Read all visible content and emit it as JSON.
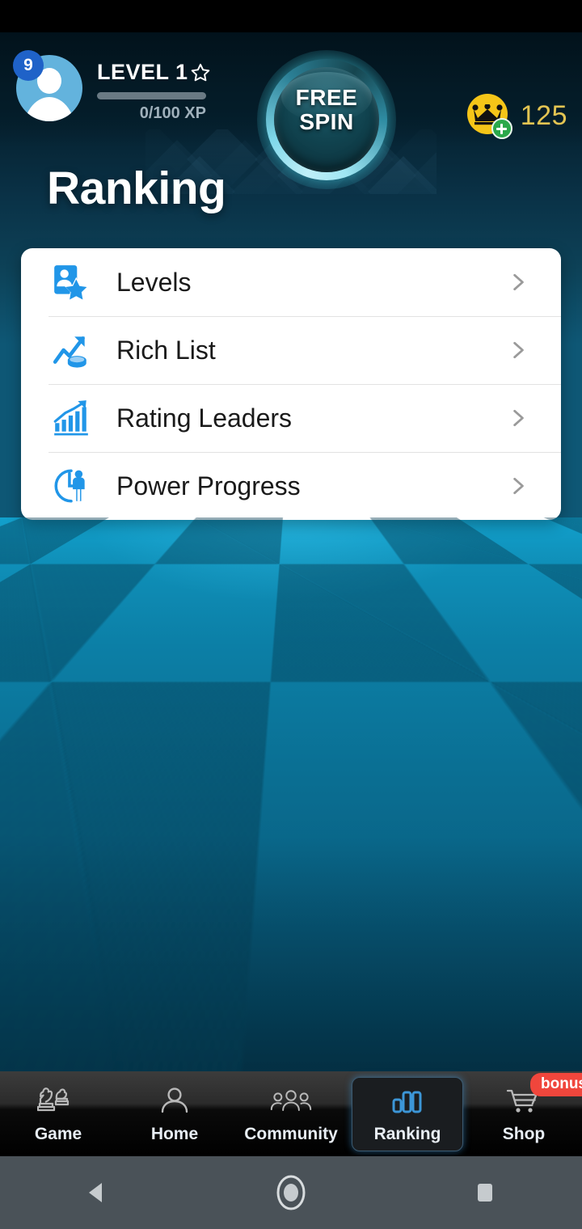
{
  "header": {
    "avatar_badge": "9",
    "level_label": "LEVEL 1",
    "xp_text": "0/100 XP",
    "xp_current": 0,
    "xp_max": 100,
    "xp_percent": 0,
    "spin_button_line1": "FREE",
    "spin_button_line2": "SPIN",
    "coin_count": "125",
    "colors": {
      "coin": "#f5c518",
      "coin_text": "#e3c452",
      "plus_badge": "#2aa84a",
      "badge_blue": "#1f62c8",
      "spin_glow": "#46dcf0"
    }
  },
  "page": {
    "title": "Ranking"
  },
  "menu": {
    "items": [
      {
        "label": "Levels",
        "icon": "levels-star-icon",
        "chevron": "chevron-right-icon"
      },
      {
        "label": "Rich List",
        "icon": "trend-coin-icon",
        "chevron": "chevron-right-icon"
      },
      {
        "label": "Rating Leaders",
        "icon": "bar-chart-trend-icon",
        "chevron": "chevron-right-icon"
      },
      {
        "label": "Power Progress",
        "icon": "clock-person-icon",
        "chevron": "chevron-right-icon"
      }
    ],
    "accent_color": "#2196e8"
  },
  "bottom_nav": {
    "active": "Ranking",
    "items": [
      {
        "label": "Game",
        "icon": "chess-pieces-icon",
        "active": false,
        "badge": ""
      },
      {
        "label": "Home",
        "icon": "person-icon",
        "active": false,
        "badge": ""
      },
      {
        "label": "Community",
        "icon": "people-group-icon",
        "active": false,
        "badge": ""
      },
      {
        "label": "Ranking",
        "icon": "bar-chart-icon",
        "active": true,
        "badge": ""
      },
      {
        "label": "Shop",
        "icon": "shopping-cart-icon",
        "active": false,
        "badge": "bonus"
      }
    ],
    "active_color": "#3c96d7",
    "badge_color": "#f0463c"
  },
  "system_nav": {
    "back": "back-triangle-icon",
    "home": "home-circle-icon",
    "recents": "recents-square-icon"
  }
}
